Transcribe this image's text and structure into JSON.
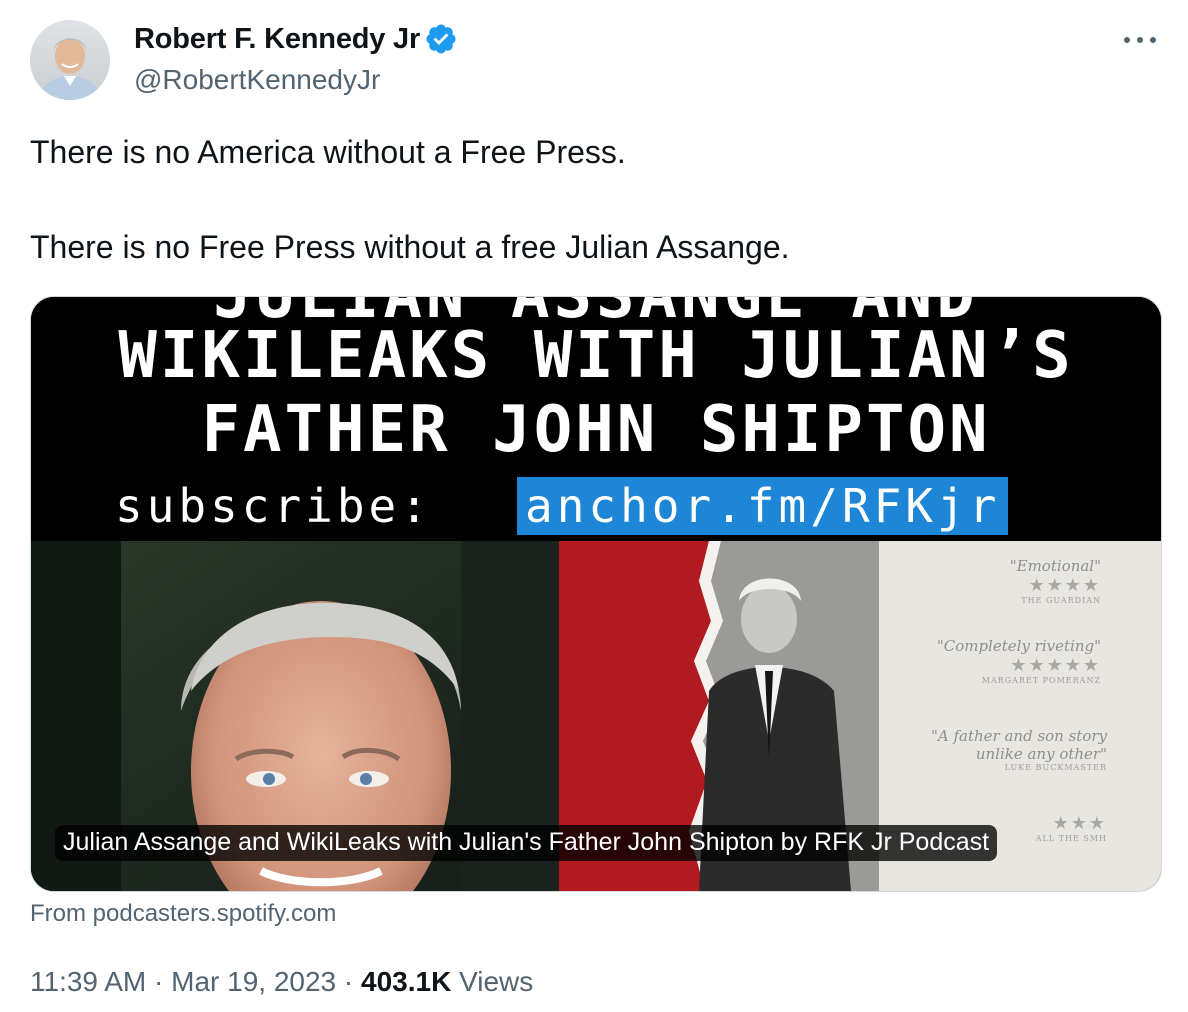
{
  "author": {
    "display_name": "Robert F. Kennedy Jr",
    "handle": "@RobertKennedyJr",
    "verified": true,
    "avatar_icon": "profile-photo"
  },
  "menu": {
    "more_icon": "more-horizontal-icon"
  },
  "tweet": {
    "lines": [
      "There is no America without a Free Press.",
      "There is no Free Press without a free Julian Assange."
    ]
  },
  "card": {
    "image": {
      "headline_cut": "JULIAN ASSANGE AND",
      "headline_line1": "WIKILEAKS WITH JULIAN’S",
      "headline_line2": "FATHER JOHN SHIPTON",
      "subscribe_label": "subscribe:",
      "subscribe_link": "anchor.fm/RFKjr",
      "poster_quotes": [
        {
          "text": "\"Emotional\"",
          "stars": "★★★★",
          "source": "THE GUARDIAN"
        },
        {
          "text": "\"Completely riveting\"",
          "stars": "★★★★★",
          "source": "MARGARET POMERANZ"
        },
        {
          "text": "\"A father and son story",
          "text2": "unlike any other\"",
          "stars": "",
          "source": "LUKE BUCKMASTER"
        },
        {
          "text": "",
          "stars": "★★★",
          "source": "ALL THE SMH"
        }
      ]
    },
    "caption": "Julian Assange and WikiLeaks with Julian's Father John Shipton by RFK Jr Podcast",
    "source": "From podcasters.spotify.com"
  },
  "meta": {
    "time": "11:39 AM",
    "separator": "·",
    "date": "Mar 19, 2023",
    "views_count": "403.1K",
    "views_label": "Views"
  },
  "colors": {
    "accent_blue": "#1d9bf0",
    "link_highlight": "#1e86d6",
    "secondary_text": "#536471",
    "primary_text": "#0f1419"
  }
}
